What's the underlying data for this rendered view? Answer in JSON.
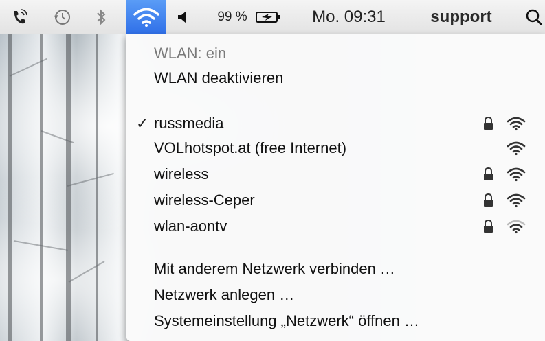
{
  "menubar": {
    "battery_text": "99 %",
    "clock": "Mo. 09:31",
    "user": "support",
    "icons": [
      "phone-icon",
      "time-machine-icon",
      "bluetooth-icon",
      "wifi-icon",
      "volume-icon",
      "battery-icon",
      "spotlight-icon"
    ]
  },
  "wlan_menu": {
    "status": "WLAN: ein",
    "toggle": "WLAN deaktivieren",
    "networks": [
      {
        "name": "russmedia",
        "checked": true,
        "locked": true,
        "signal": "full"
      },
      {
        "name": "VOLhotspot.at (free Internet)",
        "checked": false,
        "locked": false,
        "signal": "full"
      },
      {
        "name": "wireless",
        "checked": false,
        "locked": true,
        "signal": "full"
      },
      {
        "name": "wireless-Ceper",
        "checked": false,
        "locked": true,
        "signal": "full"
      },
      {
        "name": "wlan-aontv",
        "checked": false,
        "locked": true,
        "signal": "weak"
      }
    ],
    "checkmark": "✓",
    "actions": {
      "join_other": "Mit anderem Netzwerk verbinden …",
      "create": "Netzwerk anlegen …",
      "open_prefs": "Systemeinstellung „Netzwerk“ öffnen …"
    }
  },
  "colors": {
    "menubar_active": "#2f6fe8",
    "separator": "#d4d4d4",
    "status_text": "#7a7a7a"
  }
}
